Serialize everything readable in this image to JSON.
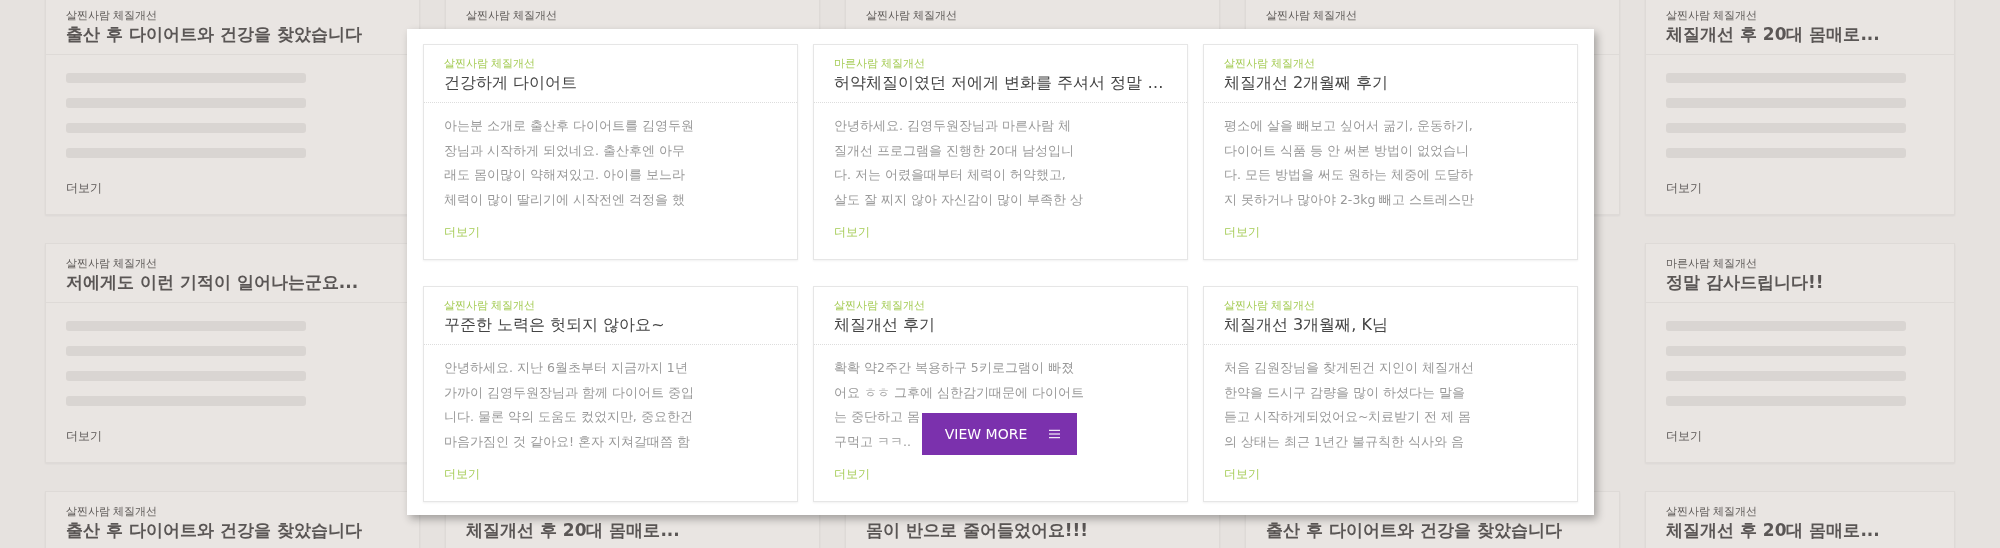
{
  "background_columns": [
    {
      "cards": [
        {
          "category": "살찐사람 체질개선",
          "title": "출산 후 다이어트와 건강을 찾았습니다",
          "more": "더보기"
        },
        {
          "category": "살찐사람 체질개선",
          "title": "저에게도 이런 기적이 일어나는군요...",
          "more": "더보기"
        },
        {
          "category": "살찐사람 체질개선",
          "title": "출산 후 다이어트와 건강을 찾았습니다"
        }
      ]
    },
    {
      "cards": [
        {
          "category": "살찐사람 체질개선"
        },
        {
          "title": "체질개선 후 20대 몸매로..."
        }
      ]
    },
    {
      "cards": [
        {
          "category": "살찐사람 체질개선"
        },
        {
          "title": "몸이 반으로 줄어들었어요!!!"
        }
      ]
    },
    {
      "cards": [
        {
          "category": "살찐사람 체질개선"
        },
        {
          "title": "출산 후 다이어트와 건강을 찾았습니다"
        }
      ]
    },
    {
      "cards": [
        {
          "category": "살찐사람 체질개선",
          "title": "체질개선 후 20대 몸매로...",
          "more": "더보기"
        },
        {
          "category": "마른사람 체질개선",
          "title": "정말 감사드립니다!!",
          "more": "더보기"
        },
        {
          "category": "살찐사람 체질개선",
          "title": "체질개선 후 20대 몸매로..."
        }
      ]
    }
  ],
  "reviews": [
    {
      "category": "살찐사람 체질개선",
      "title": "건강하게 다이어트",
      "body": [
        "아는분 소개로 출산후 다이어트를 김영두원",
        "장님과 시작하게 되었네요. 출산후엔 아무",
        "래도 몸이많이 약해져있고. 아이를 보느라",
        "체력이 많이 딸리기에 시작전엔 걱정을 했"
      ],
      "more": "더보기"
    },
    {
      "category": "마른사람 체질개선",
      "title": "허약체질이였던 저에게 변화를 주셔서 정말 …",
      "body": [
        "안녕하세요. 김영두원장님과 마른사람 체",
        "질개선 프로그램을 진행한 20대 남성입니",
        "다.  저는 어렸을때부터 체력이 허약했고,",
        "살도 잘 찌지 않아 자신감이 많이 부족한 상"
      ],
      "more": "더보기"
    },
    {
      "category": "살찐사람 체질개선",
      "title": "체질개선 2개월째 후기",
      "body": [
        "평소에 살을 빼보고 싶어서 굶기, 운동하기,",
        "다이어트 식품 등 안 써본 방법이 없었습니",
        "다. 모든 방법을 써도 원하는 체중에 도달하",
        "지 못하거나 많아야 2-3kg 빼고 스트레스만"
      ],
      "more": "더보기"
    },
    {
      "category": "살찐사람 체질개선",
      "title": "꾸준한 노력은 헛되지 않아요~",
      "body": [
        "안녕하세요. 지난 6월초부터 지금까지 1년",
        "가까이 김영두원장님과 함께 다이어트 중입",
        "니다. 물론 약의 도움도 컸었지만, 중요한건",
        "마음가짐인 것 같아요! 혼자 지쳐갈때쯤 함"
      ],
      "more": "더보기"
    },
    {
      "category": "살찐사람 체질개선",
      "title": "체질개선 후기",
      "body": [
        "확확 약2주간 복용하구 5키로그램이 빠졌",
        "어요 ㅎㅎ 그후에 심한감기때문에 다이어트",
        "는 중단하고 몸",
        "구먹고 ㅋㅋ.."
      ],
      "more": "더보기"
    },
    {
      "category": "살찐사람 체질개선",
      "title": "체질개선 3개월째, K님",
      "body": [
        "처음 김원장님을 찾게된건 지인이 체질개선",
        "한약을 드시구 감량을 많이 하셨다는 말을",
        "듣고 시작하게되었어요~치료받기 전 제 몸",
        "의 상태는 최근 1년간 불규칙한 식사와 음"
      ],
      "more": "더보기"
    }
  ],
  "view_more": {
    "label": "VIEW MORE"
  }
}
